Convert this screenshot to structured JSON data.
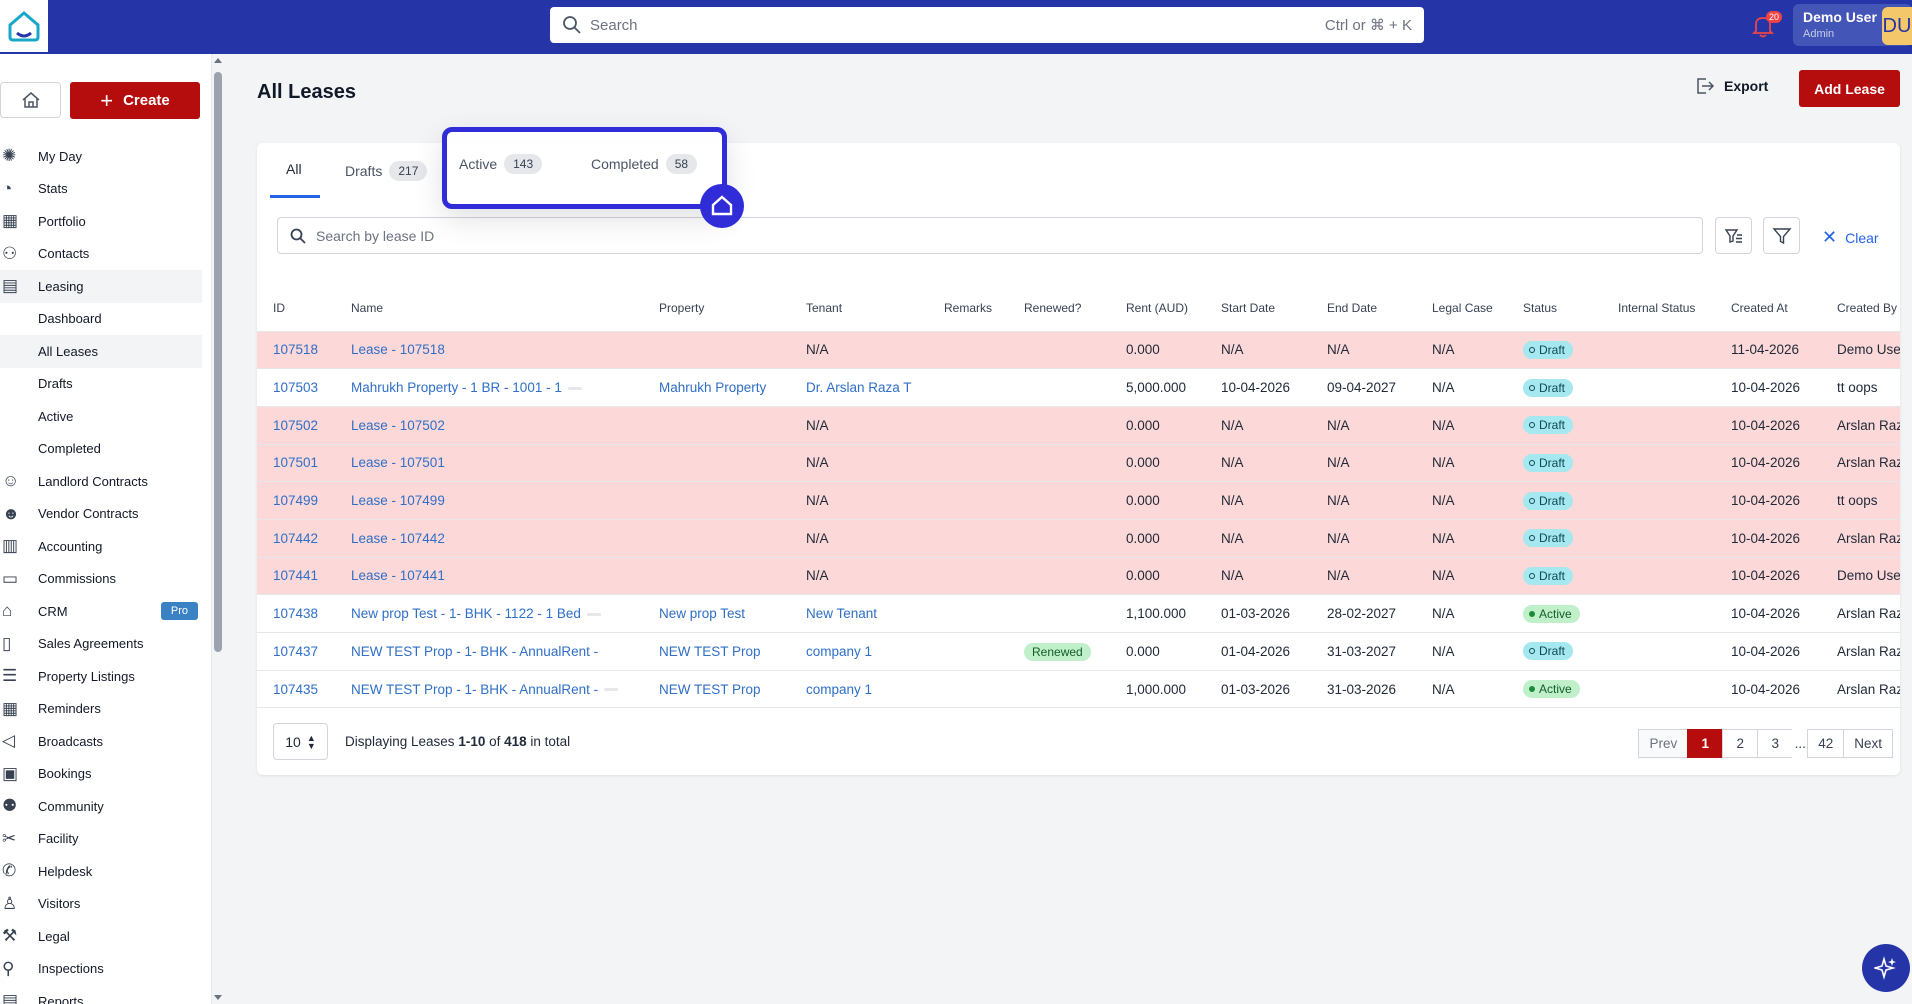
{
  "header": {
    "search_placeholder": "Search",
    "search_shortcut": "Ctrl or ⌘ + K",
    "notifications_count": "20",
    "user_name": "Demo User",
    "user_role": "Admin",
    "user_initials": "DU"
  },
  "sidebar": {
    "create_label": "Create",
    "items": [
      {
        "label": "My Day",
        "icon": "sun-icon"
      },
      {
        "label": "Stats",
        "icon": "pie-chart-icon"
      },
      {
        "label": "Portfolio",
        "icon": "building-icon"
      },
      {
        "label": "Contacts",
        "icon": "users-icon"
      },
      {
        "label": "Leasing",
        "icon": "document-icon"
      },
      {
        "label": "Dashboard",
        "sub": true
      },
      {
        "label": "All Leases",
        "sub": true
      },
      {
        "label": "Drafts",
        "sub": true
      },
      {
        "label": "Active",
        "sub": true
      },
      {
        "label": "Completed",
        "sub": true
      },
      {
        "label": "Landlord Contracts",
        "icon": "landlord-icon"
      },
      {
        "label": "Vendor Contracts",
        "icon": "vendor-icon"
      },
      {
        "label": "Accounting",
        "icon": "ledger-icon"
      },
      {
        "label": "Commissions",
        "icon": "cash-icon"
      },
      {
        "label": "CRM",
        "icon": "storefront-icon",
        "badge": "Pro"
      },
      {
        "label": "Sales Agreements",
        "icon": "file-icon"
      },
      {
        "label": "Property Listings",
        "icon": "list-icon"
      },
      {
        "label": "Reminders",
        "icon": "calendar-grid-icon"
      },
      {
        "label": "Broadcasts",
        "icon": "megaphone-icon"
      },
      {
        "label": "Bookings",
        "icon": "calendar-icon"
      },
      {
        "label": "Community",
        "icon": "community-icon"
      },
      {
        "label": "Facility",
        "icon": "tools-icon"
      },
      {
        "label": "Helpdesk",
        "icon": "phone-icon"
      },
      {
        "label": "Visitors",
        "icon": "visitor-icon"
      },
      {
        "label": "Legal",
        "icon": "gavel-icon"
      },
      {
        "label": "Inspections",
        "icon": "magnifier-icon"
      },
      {
        "label": "Reports",
        "icon": "report-icon"
      }
    ]
  },
  "page": {
    "title": "All Leases",
    "export_label": "Export",
    "add_lease_label": "Add Lease"
  },
  "tabs": [
    {
      "label": "All",
      "count": ""
    },
    {
      "label": "Drafts",
      "count": "217"
    },
    {
      "label": "Active",
      "count": "143"
    },
    {
      "label": "Completed",
      "count": "58"
    }
  ],
  "filters": {
    "search_placeholder": "Search by lease ID",
    "clear_label": "Clear"
  },
  "table": {
    "columns": [
      "ID",
      "Name",
      "Property",
      "Tenant",
      "Remarks",
      "Renewed?",
      "Rent (AUD)",
      "Start Date",
      "End Date",
      "Legal Case",
      "Status",
      "Internal Status",
      "Created At",
      "Created By"
    ],
    "rows": [
      {
        "id": "107518",
        "name": "Lease - 107518",
        "property": "",
        "tenant": "N/A",
        "renewed": "",
        "rent": "0.000",
        "start": "N/A",
        "end": "N/A",
        "legal": "N/A",
        "status": "Draft",
        "created_at": "11-04-2026",
        "created_by": "Demo User",
        "pink": true,
        "dash": false,
        "tenant_link": false
      },
      {
        "id": "107503",
        "name": "Mahrukh Property - 1 BR - 1001 - 1",
        "property": "Mahrukh Property",
        "tenant": "Dr. Arslan Raza T",
        "renewed": "",
        "rent": "5,000.000",
        "start": "10-04-2026",
        "end": "09-04-2027",
        "legal": "N/A",
        "status": "Draft",
        "created_at": "10-04-2026",
        "created_by": "tt oops",
        "pink": false,
        "dash": true,
        "tenant_link": true
      },
      {
        "id": "107502",
        "name": "Lease - 107502",
        "property": "",
        "tenant": "N/A",
        "renewed": "",
        "rent": "0.000",
        "start": "N/A",
        "end": "N/A",
        "legal": "N/A",
        "status": "Draft",
        "created_at": "10-04-2026",
        "created_by": "Arslan Raza",
        "pink": true,
        "dash": false,
        "tenant_link": false
      },
      {
        "id": "107501",
        "name": "Lease - 107501",
        "property": "",
        "tenant": "N/A",
        "renewed": "",
        "rent": "0.000",
        "start": "N/A",
        "end": "N/A",
        "legal": "N/A",
        "status": "Draft",
        "created_at": "10-04-2026",
        "created_by": "Arslan Raza",
        "pink": true,
        "dash": false,
        "tenant_link": false
      },
      {
        "id": "107499",
        "name": "Lease - 107499",
        "property": "",
        "tenant": "N/A",
        "renewed": "",
        "rent": "0.000",
        "start": "N/A",
        "end": "N/A",
        "legal": "N/A",
        "status": "Draft",
        "created_at": "10-04-2026",
        "created_by": "tt oops",
        "pink": true,
        "dash": false,
        "tenant_link": false
      },
      {
        "id": "107442",
        "name": "Lease - 107442",
        "property": "",
        "tenant": "N/A",
        "renewed": "",
        "rent": "0.000",
        "start": "N/A",
        "end": "N/A",
        "legal": "N/A",
        "status": "Draft",
        "created_at": "10-04-2026",
        "created_by": "Arslan Raza",
        "pink": true,
        "dash": false,
        "tenant_link": false
      },
      {
        "id": "107441",
        "name": "Lease - 107441",
        "property": "",
        "tenant": "N/A",
        "renewed": "",
        "rent": "0.000",
        "start": "N/A",
        "end": "N/A",
        "legal": "N/A",
        "status": "Draft",
        "created_at": "10-04-2026",
        "created_by": "Demo User",
        "pink": true,
        "dash": false,
        "tenant_link": false
      },
      {
        "id": "107438",
        "name": "New prop Test - 1- BHK - 1122 - 1 Bed",
        "property": "New prop Test",
        "tenant": "New Tenant",
        "renewed": "",
        "rent": "1,100.000",
        "start": "01-03-2026",
        "end": "28-02-2027",
        "legal": "N/A",
        "status": "Active",
        "created_at": "10-04-2026",
        "created_by": "Arslan Raza",
        "pink": false,
        "dash": true,
        "tenant_link": true
      },
      {
        "id": "107437",
        "name": "NEW TEST Prop - 1- BHK - AnnualRent -",
        "property": "NEW TEST Prop",
        "tenant": "company 1",
        "renewed": "Renewed",
        "rent": "0.000",
        "start": "01-04-2026",
        "end": "31-03-2027",
        "legal": "N/A",
        "status": "Draft",
        "created_at": "10-04-2026",
        "created_by": "Arslan Raza",
        "pink": false,
        "dash": false,
        "tenant_link": true
      },
      {
        "id": "107435",
        "name": "NEW TEST Prop - 1- BHK - AnnualRent -",
        "property": "NEW TEST Prop",
        "tenant": "company 1",
        "renewed": "",
        "rent": "1,000.000",
        "start": "01-03-2026",
        "end": "31-03-2026",
        "legal": "N/A",
        "status": "Active",
        "created_at": "10-04-2026",
        "created_by": "Arslan Raza",
        "pink": false,
        "dash": true,
        "tenant_link": true
      }
    ]
  },
  "footer": {
    "per_page": "10",
    "display_prefix": "Displaying Leases ",
    "display_range": "1-10",
    "display_of": " of ",
    "display_total": "418",
    "display_suffix": " in total",
    "prev_label": "Prev",
    "next_label": "Next",
    "pages": [
      "1",
      "2",
      "3",
      "...",
      "42"
    ],
    "current_page": "1"
  },
  "colors": {
    "topbar": "#2535a8",
    "brand_red": "#b50d0d",
    "link": "#2f6fc7",
    "highlight": "#2f2cd8"
  }
}
